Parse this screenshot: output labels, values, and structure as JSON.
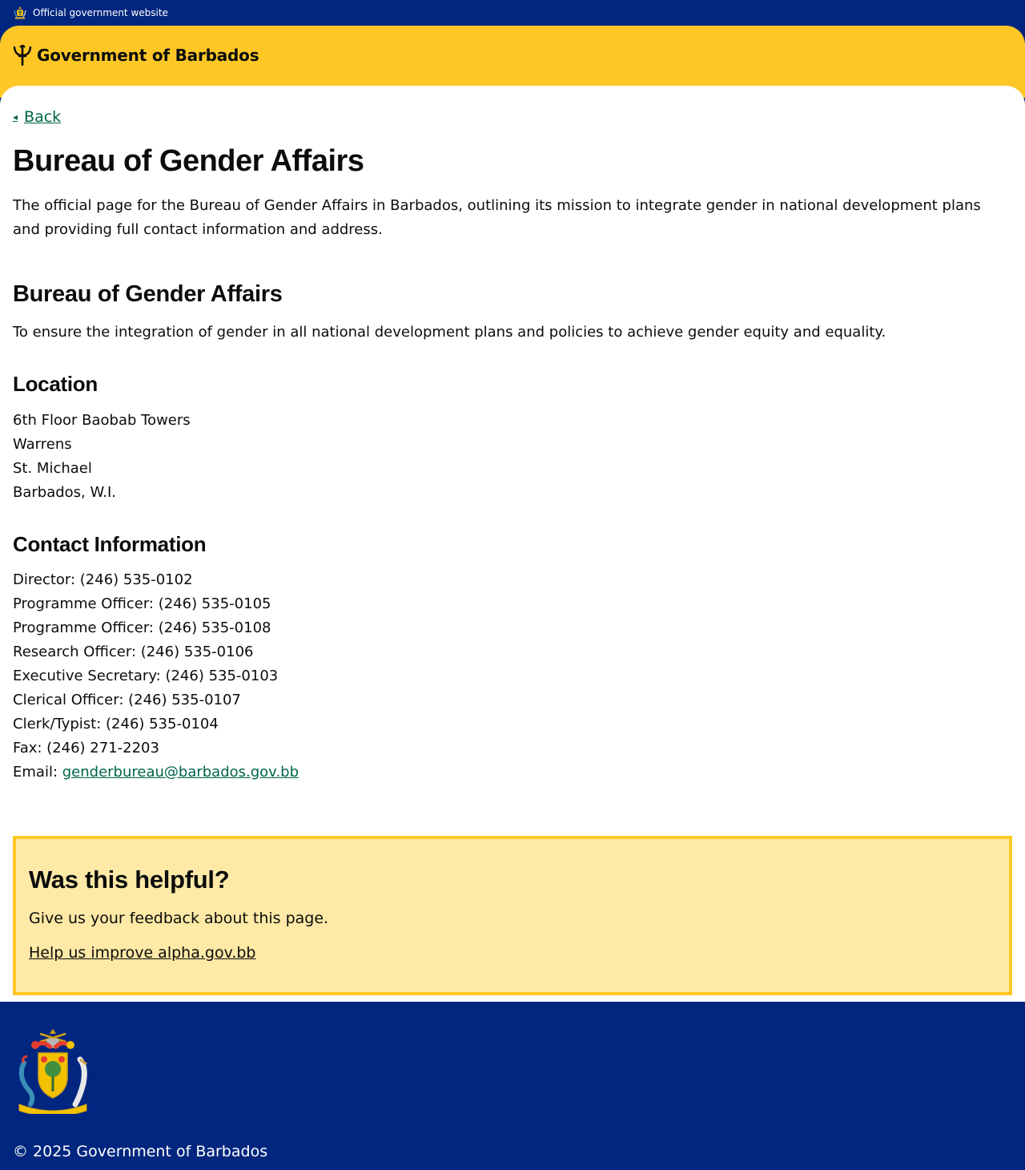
{
  "topbar": {
    "text": "Official government website"
  },
  "header": {
    "brand": "Government of Barbados"
  },
  "nav": {
    "back_label": "Back"
  },
  "page": {
    "title": "Bureau of Gender Affairs",
    "lede": "The official page for the Bureau of Gender Affairs in Barbados, outlining its mission to integrate gender in national development plans and providing full contact information and address."
  },
  "section": {
    "title": "Bureau of Gender Affairs",
    "mission": "To ensure the integration of gender in all national development plans and policies to achieve gender equity and equality."
  },
  "location": {
    "title": "Location",
    "lines": [
      "6th Floor Baobab Towers",
      "Warrens",
      "St. Michael",
      "Barbados, W.I."
    ]
  },
  "contact": {
    "title": "Contact Information",
    "lines": [
      "Director: (246) 535-0102",
      "Programme Officer: (246) 535-0105",
      "Programme Officer: (246) 535-0108",
      "Research Officer: (246) 535-0106",
      "Executive Secretary: (246) 535-0103",
      "Clerical Officer: (246) 535-0107",
      "Clerk/Typist: (246) 535-0104",
      "Fax: (246) 271-2203"
    ],
    "email_label": "Email: ",
    "email": "genderbureau@barbados.gov.bb"
  },
  "feedback": {
    "title": "Was this helpful?",
    "text": "Give us your feedback about this page.",
    "link": "Help us improve alpha.gov.bb"
  },
  "footer": {
    "copyright": "© 2025 Government of Barbados"
  },
  "colors": {
    "navy": "#00267f",
    "gold": "#ffc726",
    "feedback_bg": "#fee9a6",
    "link_green": "#00654a"
  },
  "icons": {
    "topbar": "coat-of-arms-small-icon",
    "brand": "trident-icon",
    "back": "arrow-left-icon",
    "footer": "coat-of-arms-icon"
  }
}
